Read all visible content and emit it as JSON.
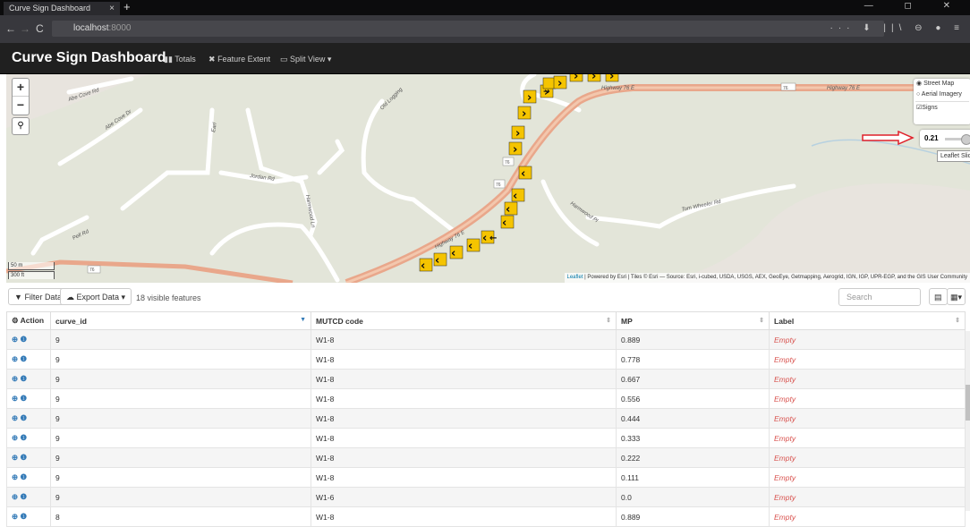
{
  "browser": {
    "tab_title": "Curve Sign Dashboard",
    "tab_close": "×",
    "new_tab": "+",
    "window_controls": "— ◻ ✕",
    "nav_back": "←",
    "nav_forward": "→",
    "nav_reload": "C",
    "url_host": "localhost",
    "url_port": ":8000",
    "toolbar_icons": "··· ⬇ ||\\ ⊖ ● ≡"
  },
  "app": {
    "title": "Curve Sign Dashboard",
    "menu": [
      {
        "icon": "bar-chart-icon",
        "glyph": "▮▮",
        "label": "Totals"
      },
      {
        "icon": "expand-arrows-icon",
        "glyph": "✖",
        "label": "Feature Extent"
      },
      {
        "icon": "laptop-icon",
        "glyph": "▭",
        "label": "Split View ▾"
      }
    ]
  },
  "map": {
    "zoom_in": "+",
    "zoom_out": "−",
    "search_glyph": "⚲",
    "layers": {
      "street": "Street Map",
      "aerial": "Aerial Imagery",
      "signs": "Signs"
    },
    "slider_value": "0.21",
    "slider_fraction": 0.21,
    "slider_tooltip": "Leaflet Slider",
    "scale_metric": "50 m",
    "scale_imperial": "300 ft",
    "attribution_link": "Leaflet",
    "attribution_text": " | Powered by Esri | Tiles © Esri — Source: Esri, i-cubed, USDA, USGS, AEX, GeoEye, Getmapping, Aerogrid, IGN, IGP, UPR-EGP, and the GIS User Community",
    "road_labels": [
      "Abe Cove Rd",
      "Abe Cove Dr",
      "Earl",
      "Old Logging",
      "Jordan Rd",
      "Harmwood Ln",
      "Highway 76 E",
      "Highway 76 E",
      "Highway 76 E",
      "Tom Wheeler Rd",
      "Harmwood Pl",
      "Pell Rd"
    ],
    "shields": [
      "76",
      "76",
      "76",
      "76"
    ]
  },
  "toolbar": {
    "filter_label": "Filter Data",
    "filter_icon": "funnel-icon",
    "export_label": "Export Data ▾",
    "export_icon": "cloud-icon",
    "visible_text": "18 visible features",
    "search_placeholder": "Search",
    "table_icon": "▤",
    "columns_icon": "▦▾"
  },
  "table": {
    "headers": [
      "⚙ Action",
      "curve_id",
      "MUTCD code",
      "MP",
      "Label"
    ],
    "rows": [
      {
        "curve_id": "9",
        "mutcd": "W1-8",
        "mp": "0.889",
        "label": "Empty"
      },
      {
        "curve_id": "9",
        "mutcd": "W1-8",
        "mp": "0.778",
        "label": "Empty"
      },
      {
        "curve_id": "9",
        "mutcd": "W1-8",
        "mp": "0.667",
        "label": "Empty"
      },
      {
        "curve_id": "9",
        "mutcd": "W1-8",
        "mp": "0.556",
        "label": "Empty"
      },
      {
        "curve_id": "9",
        "mutcd": "W1-8",
        "mp": "0.444",
        "label": "Empty"
      },
      {
        "curve_id": "9",
        "mutcd": "W1-8",
        "mp": "0.333",
        "label": "Empty"
      },
      {
        "curve_id": "9",
        "mutcd": "W1-8",
        "mp": "0.222",
        "label": "Empty"
      },
      {
        "curve_id": "9",
        "mutcd": "W1-8",
        "mp": "0.111",
        "label": "Empty"
      },
      {
        "curve_id": "9",
        "mutcd": "W1-6",
        "mp": "0.0",
        "label": "Empty"
      },
      {
        "curve_id": "8",
        "mutcd": "W1-8",
        "mp": "0.889",
        "label": "Empty"
      }
    ],
    "action_glyphs": "⊕ ❶"
  }
}
